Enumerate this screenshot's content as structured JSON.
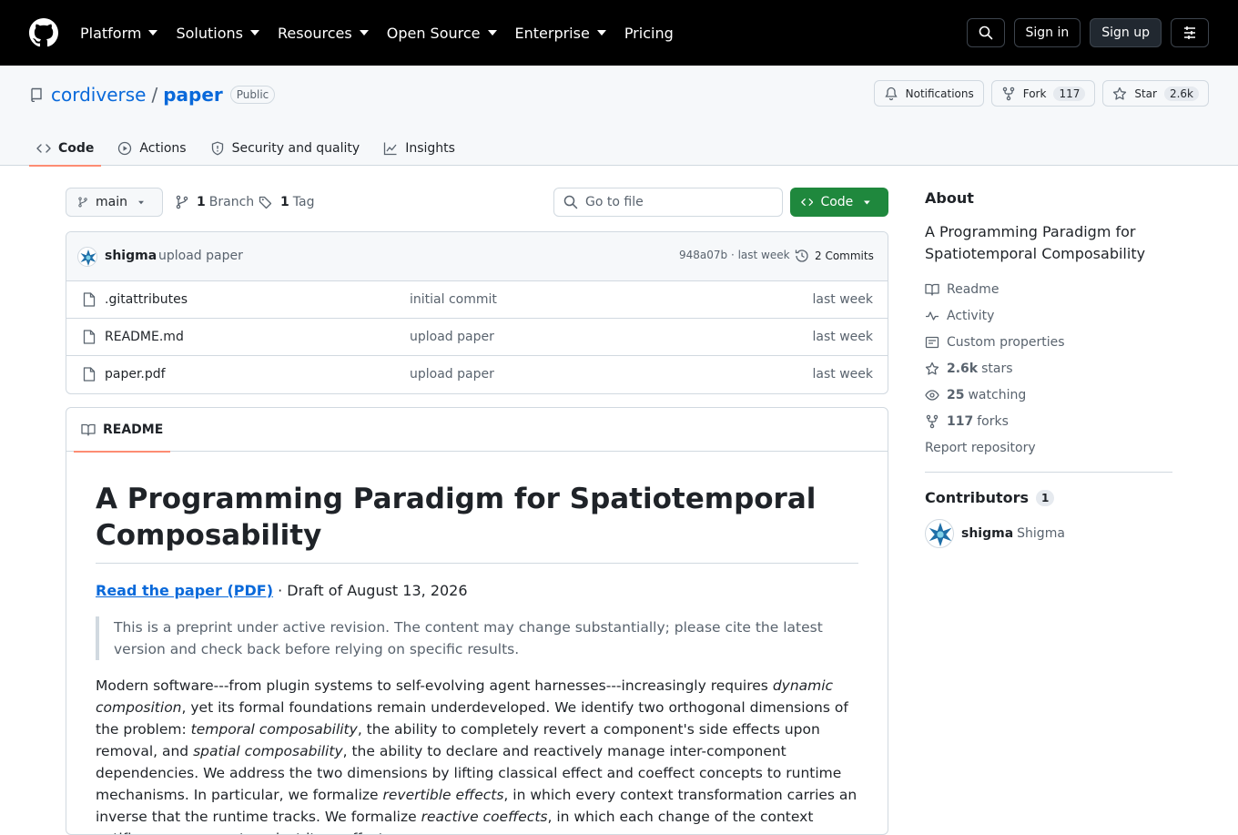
{
  "nav": {
    "links": [
      "Platform",
      "Solutions",
      "Resources",
      "Open Source",
      "Enterprise",
      "Pricing"
    ],
    "sign_in": "Sign in",
    "sign_up": "Sign up"
  },
  "repo": {
    "owner": "cordiverse",
    "separator": "/",
    "name": "paper",
    "visibility": "Public",
    "notifications_label": "Notifications",
    "fork_label": "Fork",
    "fork_count": "117",
    "star_label": "Star",
    "star_count": "2.6k"
  },
  "tabs": [
    {
      "label": "Code"
    },
    {
      "label": "Actions"
    },
    {
      "label": "Security and quality"
    },
    {
      "label": "Insights"
    }
  ],
  "toolbar": {
    "branch": "main",
    "branch_count": "1",
    "branch_label": "Branch",
    "tag_count": "1",
    "tag_label": "Tag",
    "goto_placeholder": "Go to file",
    "code_label": "Code"
  },
  "latest_commit": {
    "author": "shigma",
    "message": "upload paper",
    "hash_time": "948a07b · last week",
    "commits": "2 Commits"
  },
  "files": [
    {
      "name": ".gitattributes",
      "message": "initial commit",
      "date": "last week"
    },
    {
      "name": "README.md",
      "message": "upload paper",
      "date": "last week"
    },
    {
      "name": "paper.pdf",
      "message": "upload paper",
      "date": "last week"
    }
  ],
  "readme": {
    "tab_label": "README",
    "heading": "A Programming Paradigm for Spatiotemporal Composability",
    "link_text": "Read the paper (PDF)",
    "draft_text": " · Draft of August 13, 2026",
    "note": "This is a preprint under active revision. The content may change substantially; please cite the latest version and check back before relying on specific results.",
    "abstract": [
      {
        "t": "Modern software---from plugin systems to self-evolving agent harnesses---increasingly requires "
      },
      {
        "t": "dynamic composition",
        "i": true
      },
      {
        "t": ", yet its formal foundations remain underdeveloped. We identify two orthogonal dimensions of the problem: "
      },
      {
        "t": "temporal composability",
        "i": true
      },
      {
        "t": ", the ability to completely revert a component's side effects upon removal, and "
      },
      {
        "t": "spatial composability",
        "i": true
      },
      {
        "t": ", the ability to declare and reactively manage inter-component dependencies. We address the two dimensions by lifting classical effect and coeffect concepts to runtime mechanisms. In particular, we formalize "
      },
      {
        "t": "revertible effects",
        "i": true
      },
      {
        "t": ", in which every context transformation carries an inverse that the runtime tracks. We formalize "
      },
      {
        "t": "reactive coeffects",
        "i": true
      },
      {
        "t": ", in which each change of the context notifies a component against its coeffect"
      }
    ]
  },
  "sidebar": {
    "about_title": "About",
    "description": "A Programming Paradigm for Spatiotemporal Composability",
    "readme": "Readme",
    "activity": "Activity",
    "custom_properties": "Custom properties",
    "stars_count": "2.6k",
    "stars_label": "stars",
    "watching_count": "25",
    "watching_label": "watching",
    "forks_count": "117",
    "forks_label": "forks",
    "report": "Report repository",
    "contributors_title": "Contributors",
    "contributors_count": "1",
    "contributor_login": "shigma",
    "contributor_name": "Shigma"
  }
}
